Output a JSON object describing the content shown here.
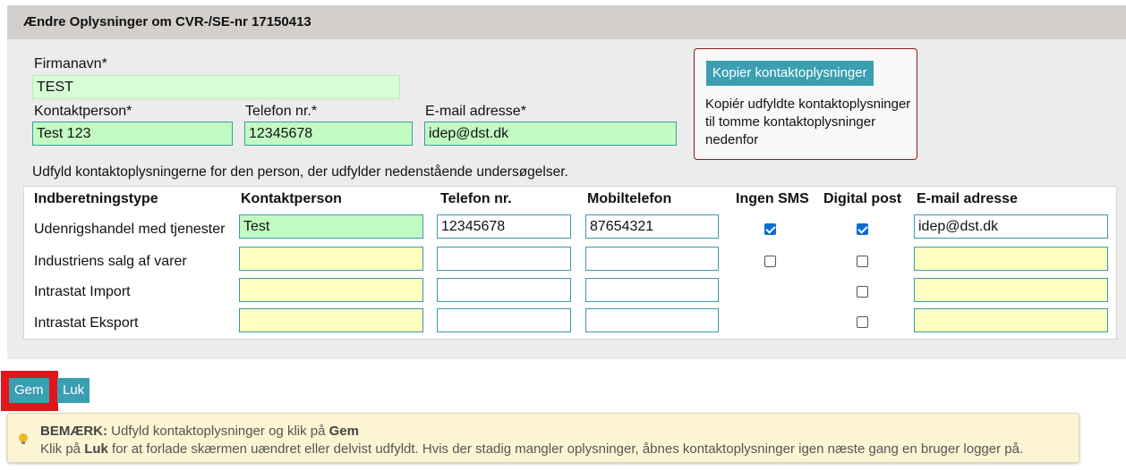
{
  "panel": {
    "title": "Ændre Oplysninger om CVR-/SE-nr 17150413"
  },
  "company": {
    "name_label": "Firmanavn*",
    "name_value": "TEST",
    "contact_label": "Kontaktperson*",
    "contact_value": "Test 123",
    "phone_label": "Telefon nr.*",
    "phone_value": "12345678",
    "email_label": "E-mail adresse*",
    "email_value": "idep@dst.dk"
  },
  "copy_box": {
    "button_label": "Kopier kontaktoplysninger",
    "description": "Kopiér udfyldte kontaktoplysninger til tomme kontaktoplysninger nedenfor"
  },
  "instruction": "Udfyld kontaktoplysningerne for den person, der udfylder nedenstående undersøgelser.",
  "table": {
    "headers": [
      "Indberetningstype",
      "Kontaktperson",
      "Telefon nr.",
      "Mobiltelefon",
      "Ingen SMS",
      "Digital post",
      "E-mail adresse"
    ],
    "rows": [
      {
        "type": "Udenrigshandel med tjenester",
        "contact": "Test",
        "phone": "12345678",
        "mobile": "87654321",
        "no_sms": true,
        "digital_post": true,
        "email": "idep@dst.dk"
      },
      {
        "type": "Industriens salg af varer",
        "contact": "",
        "phone": "",
        "mobile": "",
        "no_sms": false,
        "digital_post": false,
        "email": ""
      },
      {
        "type": "Intrastat Import",
        "contact": "",
        "phone": "",
        "mobile": "",
        "no_sms": null,
        "digital_post": false,
        "email": ""
      },
      {
        "type": "Intrastat Eksport",
        "contact": "",
        "phone": "",
        "mobile": "",
        "no_sms": null,
        "digital_post": false,
        "email": ""
      }
    ]
  },
  "actions": {
    "save_label": "Gem",
    "close_label": "Luk"
  },
  "note": {
    "label": "BEMÆRK:",
    "line1_text": "Udfyld kontaktoplysninger og klik på",
    "line1_bold": "Gem",
    "line2_prefix": "Klik på",
    "line2_bold": "Luk",
    "line2_suffix": "for at forlade skærmen uændret eller delvist udfyldt. Hvis der stadig mangler oplysninger, åbnes kontaktoplysninger igen næste gang en bruger logger på."
  },
  "colors": {
    "accent": "#3b9fb2",
    "green_field": "#c2fbc2",
    "yellow_field": "#ffffc0",
    "highlight": "#e2141c",
    "note_bg": "#fdf4d3"
  }
}
